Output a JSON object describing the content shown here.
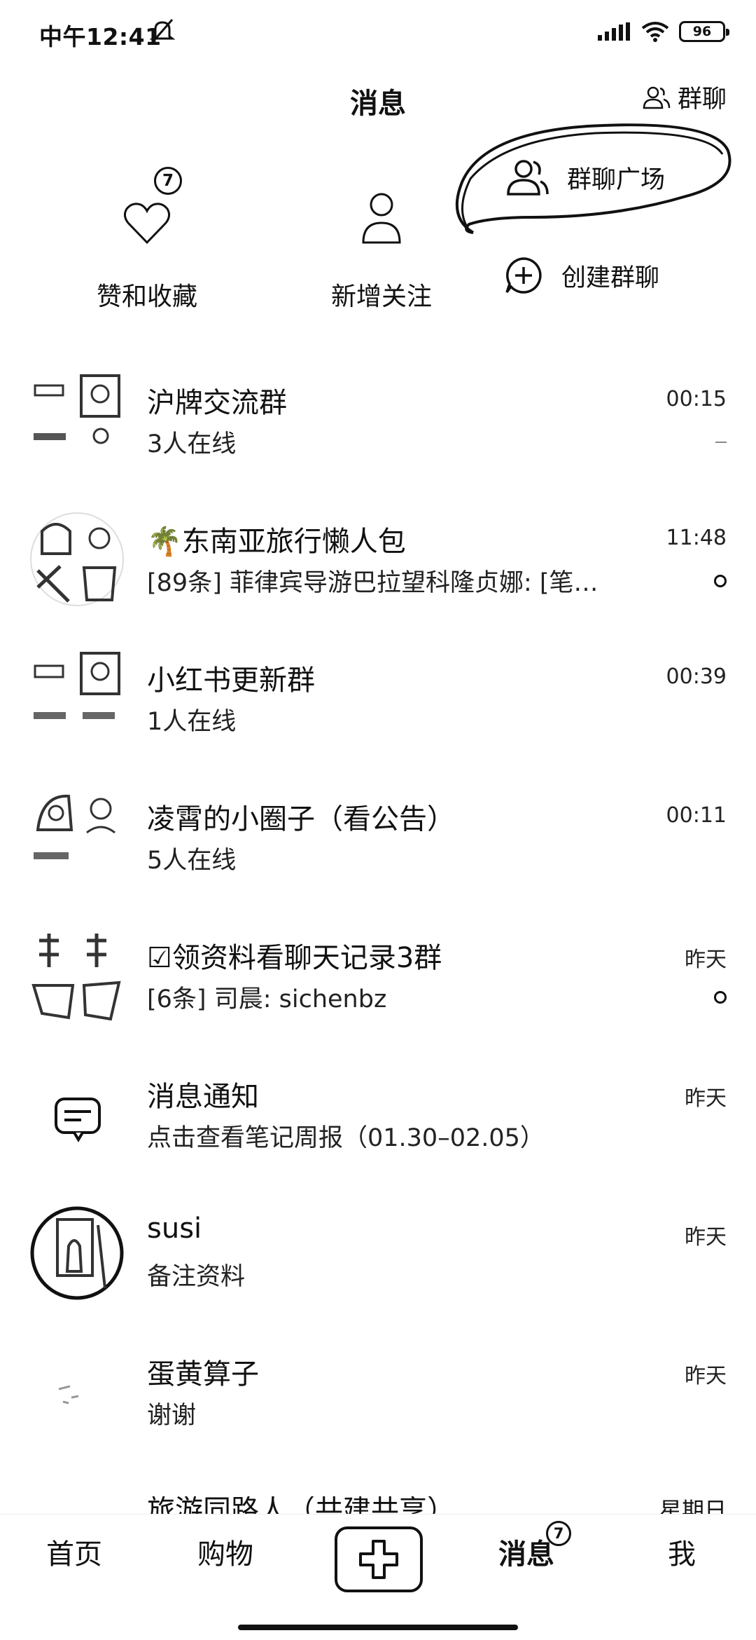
{
  "status_bar": {
    "time": "中午12:41",
    "battery": "96"
  },
  "header": {
    "title": "消息",
    "group_chat_label": "群聊"
  },
  "quick_actions": {
    "likes": {
      "label": "赞和收藏",
      "badge": "7"
    },
    "follows": {
      "label": "新增关注"
    }
  },
  "popup_menu": {
    "square_label": "群聊广场",
    "create_label": "创建群聊"
  },
  "chats": [
    {
      "name": "沪牌交流群",
      "preview": "3人在线",
      "time": "00:15",
      "indicator": "dash"
    },
    {
      "name": "东南亚旅行懒人包",
      "name_emoji": "🌴",
      "preview": "[89条] 菲律宾导游巴拉望科隆贞娜: [笔…",
      "time": "11:48",
      "indicator": "dot"
    },
    {
      "name": "小红书更新群",
      "preview": "1人在线",
      "time": "00:39",
      "indicator": "none"
    },
    {
      "name": "凌霄的小圈子（看公告）",
      "preview": "5人在线",
      "time": "00:11",
      "indicator": "none"
    },
    {
      "name": "领资料看聊天记录3群",
      "name_emoji": "☑",
      "preview": "[6条] 司晨: sichenbz",
      "time": "昨天",
      "indicator": "dot"
    },
    {
      "name": "消息通知",
      "preview": "点击查看笔记周报（01.30–02.05）",
      "time": "昨天",
      "indicator": "none",
      "avatar_icon": "message-bubble-icon"
    },
    {
      "name": "susi",
      "preview": "备注资料",
      "time": "昨天",
      "indicator": "none"
    },
    {
      "name": "蛋黄算子",
      "preview": "谢谢",
      "time": "昨天",
      "indicator": "none"
    }
  ],
  "partial_row": {
    "name": "旅游同路人（共建共享）",
    "time": "星期日"
  },
  "tab_bar": {
    "home": "首页",
    "shop": "购物",
    "messages": "消息",
    "messages_badge": "7",
    "me": "我"
  }
}
